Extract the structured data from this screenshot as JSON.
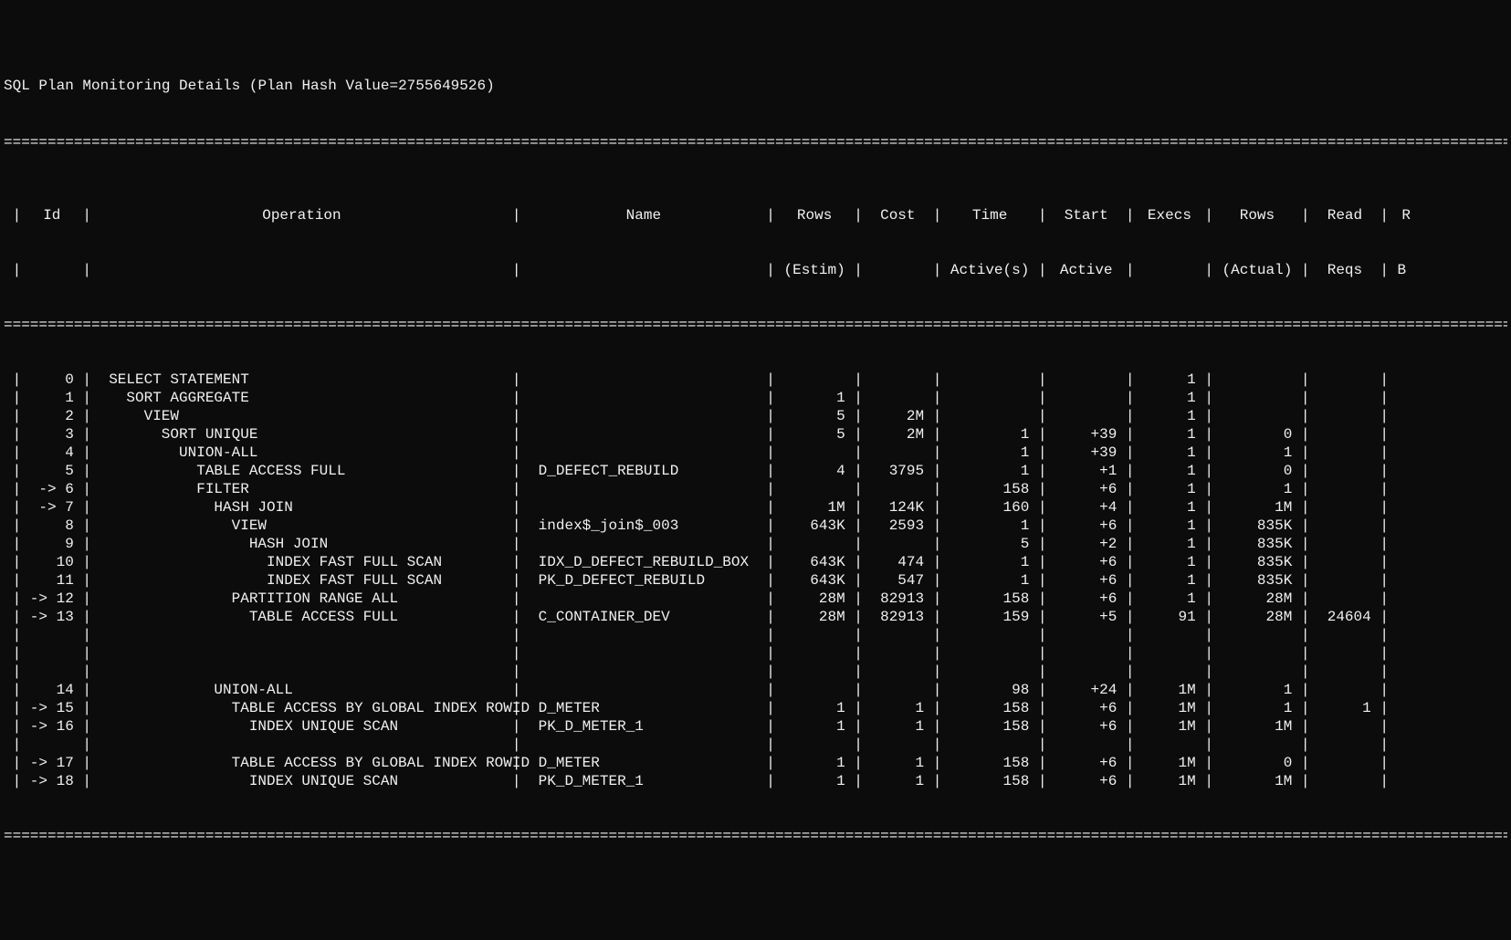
{
  "title": "SQL Plan Monitoring Details (Plan Hash Value=2755649526)",
  "headers": {
    "id": "Id",
    "operation": "Operation",
    "name": "Name",
    "rows_estim1": "Rows",
    "rows_estim2": "(Estim)",
    "cost": "Cost",
    "time1": "Time",
    "time2": "Active(s)",
    "start1": "Start",
    "start2": "Active",
    "execs": "Execs",
    "rows_act1": "Rows",
    "rows_act2": "(Actual)",
    "read1": "Read",
    "read2": "Reqs",
    "rb1": "R",
    "rb2": "B"
  },
  "rows": [
    {
      "id": "0",
      "op": "SELECT STATEMENT",
      "name": "",
      "rest": "",
      "cost": "",
      "time": "",
      "start": "",
      "exec": "1",
      "ract": "",
      "read": "",
      "rb": "",
      "indent": 0,
      "arrow": false
    },
    {
      "id": "1",
      "op": "SORT AGGREGATE",
      "name": "",
      "rest": "1",
      "cost": "",
      "time": "",
      "start": "",
      "exec": "1",
      "ract": "",
      "read": "",
      "rb": "",
      "indent": 1,
      "arrow": false
    },
    {
      "id": "2",
      "op": "VIEW",
      "name": "",
      "rest": "5",
      "cost": "2M",
      "time": "",
      "start": "",
      "exec": "1",
      "ract": "",
      "read": "",
      "rb": "",
      "indent": 2,
      "arrow": false
    },
    {
      "id": "3",
      "op": "SORT UNIQUE",
      "name": "",
      "rest": "5",
      "cost": "2M",
      "time": "1",
      "start": "+39",
      "exec": "1",
      "ract": "0",
      "read": "",
      "rb": "",
      "indent": 3,
      "arrow": false
    },
    {
      "id": "4",
      "op": "UNION-ALL",
      "name": "",
      "rest": "",
      "cost": "",
      "time": "1",
      "start": "+39",
      "exec": "1",
      "ract": "1",
      "read": "",
      "rb": "",
      "indent": 4,
      "arrow": false
    },
    {
      "id": "5",
      "op": "TABLE ACCESS FULL",
      "name": "D_DEFECT_REBUILD",
      "rest": "4",
      "cost": "3795",
      "time": "1",
      "start": "+1",
      "exec": "1",
      "ract": "0",
      "read": "",
      "rb": "",
      "indent": 5,
      "arrow": false
    },
    {
      "id": "6",
      "op": "FILTER",
      "name": "",
      "rest": "",
      "cost": "",
      "time": "158",
      "start": "+6",
      "exec": "1",
      "ract": "1",
      "read": "",
      "rb": "",
      "indent": 5,
      "arrow": true
    },
    {
      "id": "7",
      "op": "HASH JOIN",
      "name": "",
      "rest": "1M",
      "cost": "124K",
      "time": "160",
      "start": "+4",
      "exec": "1",
      "ract": "1M",
      "read": "",
      "rb": "",
      "indent": 6,
      "arrow": true
    },
    {
      "id": "8",
      "op": "VIEW",
      "name": "index$_join$_003",
      "rest": "643K",
      "cost": "2593",
      "time": "1",
      "start": "+6",
      "exec": "1",
      "ract": "835K",
      "read": "",
      "rb": "",
      "indent": 7,
      "arrow": false
    },
    {
      "id": "9",
      "op": "HASH JOIN",
      "name": "",
      "rest": "",
      "cost": "",
      "time": "5",
      "start": "+2",
      "exec": "1",
      "ract": "835K",
      "read": "",
      "rb": "",
      "indent": 8,
      "arrow": false
    },
    {
      "id": "10",
      "op": "INDEX FAST FULL SCAN",
      "name": "IDX_D_DEFECT_REBUILD_BOX",
      "rest": "643K",
      "cost": "474",
      "time": "1",
      "start": "+6",
      "exec": "1",
      "ract": "835K",
      "read": "",
      "rb": "",
      "indent": 9,
      "arrow": false
    },
    {
      "id": "11",
      "op": "INDEX FAST FULL SCAN",
      "name": "PK_D_DEFECT_REBUILD",
      "rest": "643K",
      "cost": "547",
      "time": "1",
      "start": "+6",
      "exec": "1",
      "ract": "835K",
      "read": "",
      "rb": "",
      "indent": 9,
      "arrow": false
    },
    {
      "id": "12",
      "op": "PARTITION RANGE ALL",
      "name": "",
      "rest": "28M",
      "cost": "82913",
      "time": "158",
      "start": "+6",
      "exec": "1",
      "ract": "28M",
      "read": "",
      "rb": "",
      "indent": 7,
      "arrow": true
    },
    {
      "id": "13",
      "op": "TABLE ACCESS FULL",
      "name": "C_CONTAINER_DEV",
      "rest": "28M",
      "cost": "82913",
      "time": "159",
      "start": "+5",
      "exec": "91",
      "ract": "28M",
      "read": "24604",
      "rb": "",
      "indent": 8,
      "arrow": true
    },
    {
      "blank": true
    },
    {
      "blank": true
    },
    {
      "blank": true
    },
    {
      "id": "14",
      "op": "UNION-ALL",
      "name": "",
      "rest": "",
      "cost": "",
      "time": "98",
      "start": "+24",
      "exec": "1M",
      "ract": "1",
      "read": "",
      "rb": "",
      "indent": 6,
      "arrow": false
    },
    {
      "id": "15",
      "op": "TABLE ACCESS BY GLOBAL INDEX ROWID",
      "name": "D_METER",
      "rest": "1",
      "cost": "1",
      "time": "158",
      "start": "+6",
      "exec": "1M",
      "ract": "1",
      "read": "1",
      "rb": "",
      "indent": 7,
      "arrow": true
    },
    {
      "id": "16",
      "op": "INDEX UNIQUE SCAN",
      "name": "PK_D_METER_1",
      "rest": "1",
      "cost": "1",
      "time": "158",
      "start": "+6",
      "exec": "1M",
      "ract": "1M",
      "read": "",
      "rb": "",
      "indent": 8,
      "arrow": true
    },
    {
      "blank": true
    },
    {
      "id": "17",
      "op": "TABLE ACCESS BY GLOBAL INDEX ROWID",
      "name": "D_METER",
      "rest": "1",
      "cost": "1",
      "time": "158",
      "start": "+6",
      "exec": "1M",
      "ract": "0",
      "read": "",
      "rb": "",
      "indent": 7,
      "arrow": true
    },
    {
      "id": "18",
      "op": "INDEX UNIQUE SCAN",
      "name": "PK_D_METER_1",
      "rest": "1",
      "cost": "1",
      "time": "158",
      "start": "+6",
      "exec": "1M",
      "ract": "1M",
      "read": "",
      "rb": "",
      "indent": 8,
      "arrow": true
    }
  ]
}
